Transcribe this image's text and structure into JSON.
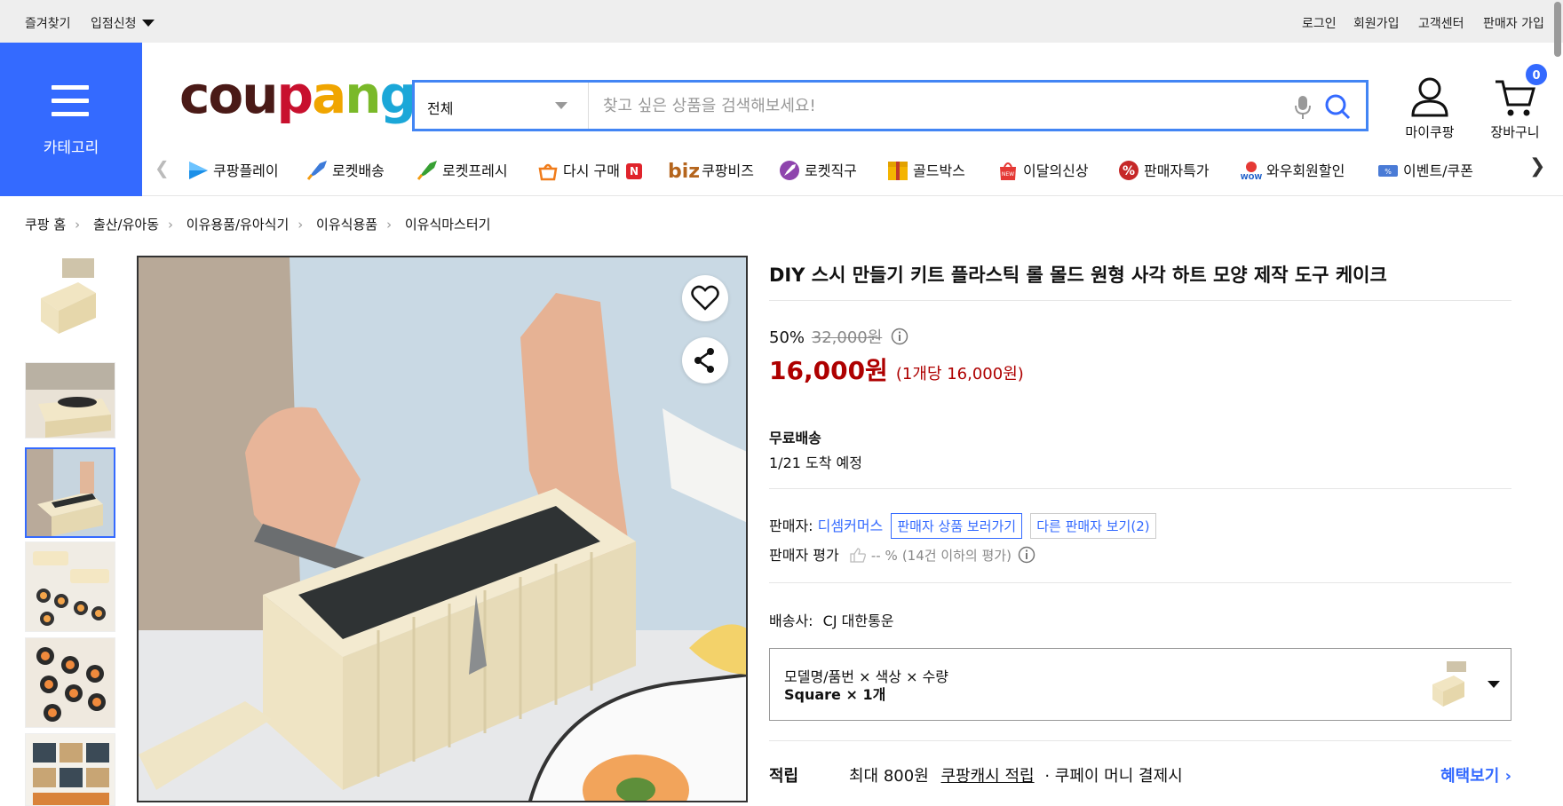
{
  "topbar": {
    "links_left": [
      "즐겨찾기",
      "입점신청"
    ],
    "links_right": [
      "로그인",
      "회원가입",
      "고객센터",
      "판매자 가입"
    ]
  },
  "header": {
    "category_label": "카테고리",
    "logo_letters": [
      "c",
      "o",
      "u",
      "p",
      "a",
      "n",
      "g"
    ],
    "search": {
      "category": "전체",
      "placeholder": "찾고 싶은 상품을 검색해보세요!"
    },
    "mycoupang_label": "마이쿠팡",
    "cart_label": "장바구니",
    "cart_count": "0"
  },
  "nav": {
    "items": [
      {
        "label": "쿠팡플레이",
        "icon": "play-icon"
      },
      {
        "label": "로켓배송",
        "icon": "rocket-icon"
      },
      {
        "label": "로켓프레시",
        "icon": "rocket-fresh-icon"
      },
      {
        "label": "다시 구매",
        "icon": "rebuy-icon",
        "badge": "N"
      },
      {
        "label": "쿠팡비즈",
        "icon": "biz-icon",
        "prefix": "biz"
      },
      {
        "label": "로켓직구",
        "icon": "rocket-global-icon"
      },
      {
        "label": "골드박스",
        "icon": "goldbox-icon"
      },
      {
        "label": "이달의신상",
        "icon": "new-bag-icon"
      },
      {
        "label": "판매자특가",
        "icon": "percent-icon"
      },
      {
        "label": "와우회원할인",
        "icon": "wow-icon"
      },
      {
        "label": "이벤트/쿠폰",
        "icon": "coupon-icon"
      }
    ]
  },
  "breadcrumb": [
    "쿠팡 홈",
    "출산/유아동",
    "이유용품/유아식기",
    "이유식용품",
    "이유식마스터기"
  ],
  "product": {
    "title": "DIY 스시 만들기 키트 플라스틱 롤 몰드 원형 사각 하트 모양 제작 도구 케이크",
    "discount_rate": "50%",
    "original_price": "32,000원",
    "sale_price": "16,000원",
    "unit_price": "(1개당 16,000원)",
    "shipping_title": "무료배송",
    "arrival": "1/21 도착 예정",
    "seller_label": "판매자:",
    "seller_name": "디셈커머스",
    "seller_products_button": "판매자 상품 보러가기",
    "other_sellers_button": "다른 판매자 보기(2)",
    "seller_rating_label": "판매자 평가",
    "seller_rating_value": "-- %",
    "seller_rating_note": "(14건 이하의 평가)",
    "courier_label": "배송사:",
    "courier_name": "CJ 대한통운",
    "option_label": "모델명/품번 × 색상 × 수량",
    "option_value": "Square × 1개",
    "reward_title": "적립",
    "reward_max": "최대 800원",
    "reward_link": "쿠팡캐시 적립",
    "reward_desc": "· 쿠페이 머니 결제시",
    "reward_more": "혜택보기 ›"
  },
  "colors": {
    "accent": "#346aff",
    "price_red": "#ae0000",
    "topbar_bg": "#eeeeee"
  }
}
